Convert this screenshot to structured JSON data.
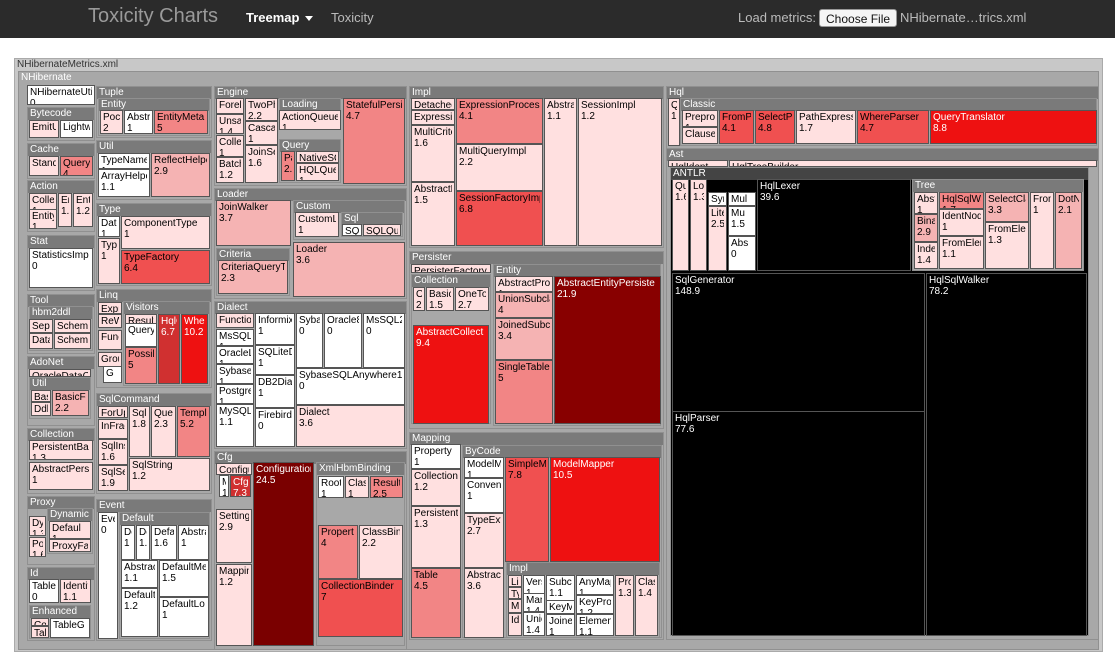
{
  "navbar": {
    "brand": "Toxicity Charts",
    "treemap_label": "Treemap",
    "toxicity_label": "Toxicity",
    "load_label": "Load metrics:",
    "choose_file_label": "Choose File",
    "file_name": "NHibernate…trics.xml"
  },
  "treemap": {
    "root_label": "NHibernateMetrics.xml",
    "main_label": "NHibernate",
    "groups": {
      "bytecode": "Bytecode",
      "cache": "Cache",
      "action": "Action",
      "stat": "Stat",
      "tool": "Tool",
      "hbm2ddl": "hbm2ddl",
      "adonet": "AdoNet",
      "util_left": "Util",
      "collection_left": "Collection",
      "proxy": "Proxy",
      "dynamic": "Dynamic",
      "id": "Id",
      "enhanced": "Enhanced",
      "tuple": "Tuple",
      "entity_tuple": "Entity",
      "util_mid": "Util",
      "type": "Type",
      "linq": "Linq",
      "visitors": "Visitors",
      "sqlcommand": "SqlCommand",
      "event": "Event",
      "default": "Default",
      "engine": "Engine",
      "loading": "Loading",
      "query": "Query",
      "loader": "Loader",
      "custom": "Custom",
      "sql": "Sql",
      "criteria": "Criteria",
      "dialect": "Dialect",
      "cfg": "Cfg",
      "xmlhbm": "XmlHbmBinding",
      "impl": "Impl",
      "persister": "Persister",
      "collection_p": "Collection",
      "entity_p": "Entity",
      "mapping": "Mapping",
      "bycode": "ByCode",
      "impl_bycode": "Impl",
      "hql": "Hql",
      "classic": "Classic",
      "ast": "Ast",
      "antlr": "ANTLR",
      "tree": "Tree"
    },
    "leaves": {
      "nhibernate_util": {
        "name": "NHibernateUti",
        "value": "0"
      },
      "emitu": {
        "name": "EmitU",
        "value": ""
      },
      "lightw": {
        "name": "Lightwe",
        "value": ""
      },
      "stand": {
        "name": "Stand",
        "value": ""
      },
      "queryh": {
        "name": "QueryH",
        "value": "4"
      },
      "collec": {
        "name": "Collec",
        "value": "1"
      },
      "en": {
        "name": "En",
        "value": "1.1"
      },
      "ent": {
        "name": "Ent",
        "value": "1.2"
      },
      "entity_a": {
        "name": "Entity",
        "value": "1"
      },
      "statistics": {
        "name": "StatisticsImp",
        "value": "0"
      },
      "sep": {
        "name": "Sep",
        "value": ""
      },
      "schem1": {
        "name": "Schem",
        "value": ""
      },
      "data": {
        "name": "Data",
        "value": ""
      },
      "schem2": {
        "name": "Schem",
        "value": ""
      },
      "oracledatac": {
        "name": "OracleDataC",
        "value": ""
      },
      "bas": {
        "name": "Bas",
        "value": ""
      },
      "basicfo": {
        "name": "BasicFo",
        "value": "2.2"
      },
      "ddl": {
        "name": "Ddl",
        "value": ""
      },
      "persistentba": {
        "name": "PersistentBa",
        "value": "1.3"
      },
      "abstractpers": {
        "name": "AbstractPers",
        "value": "1"
      },
      "dy": {
        "name": "Dy",
        "value": "1.3"
      },
      "defaul_p": {
        "name": "Defaul",
        "value": "1"
      },
      "po": {
        "name": "Po",
        "value": "1.6"
      },
      "proxyfa": {
        "name": "ProxyFa",
        "value": "1"
      },
      "tablec": {
        "name": "TableG",
        "value": "0"
      },
      "identif": {
        "name": "Identif",
        "value": "1.1"
      },
      "con": {
        "name": "Con",
        "value": ""
      },
      "tab": {
        "name": "Tab",
        "value": ""
      },
      "tableg": {
        "name": "TableG",
        "value": ""
      },
      "poco": {
        "name": "Poco",
        "value": "2"
      },
      "abstra_t": {
        "name": "Abstra",
        "value": "1"
      },
      "entitymeta": {
        "name": "EntityMeta",
        "value": "5"
      },
      "typename": {
        "name": "TypeName",
        "value": "1"
      },
      "arrayhelpe": {
        "name": "ArrayHelpe",
        "value": "1.1"
      },
      "reflecthelper": {
        "name": "ReflectHelpe",
        "value": "2.9"
      },
      "date": {
        "name": "Date",
        "value": "1"
      },
      "typ_t": {
        "name": "Typ",
        "value": "1"
      },
      "componenttype": {
        "name": "ComponentType",
        "value": "1"
      },
      "typefactory": {
        "name": "TypeFactory",
        "value": "6.4"
      },
      "expr": {
        "name": "Expr",
        "value": ""
      },
      "rew": {
        "name": "ReW",
        "value": ""
      },
      "func": {
        "name": "Func",
        "value": ""
      },
      "grou": {
        "name": "Grou",
        "value": ""
      },
      "g": {
        "name": "G",
        "value": ""
      },
      "resultop": {
        "name": "Result",
        "value": ""
      },
      "querym": {
        "name": "Query",
        "value": ""
      },
      "possib": {
        "name": "Possib",
        "value": "5"
      },
      "hqlge": {
        "name": "HqlG",
        "value": "6.7"
      },
      "where": {
        "name": "Where",
        "value": "10.2"
      },
      "forup": {
        "name": "ForUp",
        "value": ""
      },
      "infrag": {
        "name": "InFrag",
        "value": ""
      },
      "sqlins": {
        "name": "SqlIns",
        "value": "1.6"
      },
      "sqlse": {
        "name": "SqlSe",
        "value": "1.9"
      },
      "sqlu": {
        "name": "SqlU",
        "value": "1.8"
      },
      "quer": {
        "name": "Quer",
        "value": "2.3"
      },
      "templ": {
        "name": "Templa",
        "value": "5.2"
      },
      "sqlstring": {
        "name": "SqlString",
        "value": "1.2"
      },
      "even": {
        "name": "Even",
        "value": "0"
      },
      "de1": {
        "name": "De",
        "value": "1"
      },
      "de2": {
        "name": "De",
        "value": "1.1"
      },
      "defa": {
        "name": "Defa",
        "value": "1.6"
      },
      "abstra_e": {
        "name": "Abstra",
        "value": "1"
      },
      "abstrac": {
        "name": "Abstrac",
        "value": "1.1"
      },
      "defaultme": {
        "name": "DefaultMe",
        "value": "1.5"
      },
      "defaultl": {
        "name": "Defaulti",
        "value": "1.2"
      },
      "defaultlo": {
        "name": "DefaultLo",
        "value": "1"
      },
      "forek": {
        "name": "Forek",
        "value": ""
      },
      "unsa": {
        "name": "Unsa",
        "value": "1.4"
      },
      "collec_e": {
        "name": "Collec",
        "value": "1"
      },
      "batch": {
        "name": "Batch",
        "value": "1.2"
      },
      "twoph": {
        "name": "TwoPh",
        "value": "2.2"
      },
      "cascad": {
        "name": "Cascad",
        "value": "1"
      },
      "joinse": {
        "name": "JoinSe",
        "value": "1.6"
      },
      "actionqueue": {
        "name": "ActionQueue",
        "value": "1"
      },
      "pa": {
        "name": "Pa",
        "value": "2.6"
      },
      "nativesq": {
        "name": "NativeSQ",
        "value": "1"
      },
      "hqlque": {
        "name": "HQLQue",
        "value": "1"
      },
      "statefulpersi": {
        "name": "StatefulPersi",
        "value": "4.7"
      },
      "joinwalker": {
        "name": "JoinWalker",
        "value": "3.7"
      },
      "customl": {
        "name": "CustomL",
        "value": "1"
      },
      "sqlq": {
        "name": "SQL",
        "value": ""
      },
      "sqlqu": {
        "name": "SQLQu",
        "value": ""
      },
      "loader_leaf": {
        "name": "Loader",
        "value": "3.6"
      },
      "criteriaquery": {
        "name": "CriteriaQueryT",
        "value": "2.3"
      },
      "functio": {
        "name": "Functio",
        "value": ""
      },
      "mssqlc": {
        "name": "MsSQLC",
        "value": "1"
      },
      "oraclel": {
        "name": "OracleL",
        "value": "1"
      },
      "sybase": {
        "name": "Sybase",
        "value": "1"
      },
      "postgre": {
        "name": "Postgre",
        "value": "1"
      },
      "mysql": {
        "name": "MySQL",
        "value": "1.1"
      },
      "informix": {
        "name": "Informix",
        "value": "1"
      },
      "sqlited": {
        "name": "SQLiteD",
        "value": "1"
      },
      "db2dial": {
        "name": "DB2Dial",
        "value": "1"
      },
      "firebird": {
        "name": "Firebird",
        "value": "0"
      },
      "syba": {
        "name": "Syba",
        "value": "0"
      },
      "oracle8": {
        "name": "Oracle8",
        "value": "0"
      },
      "mssql20": {
        "name": "MsSQL20",
        "value": "0"
      },
      "sybaseany": {
        "name": "SybaseSQLAnywhere1",
        "value": "0"
      },
      "dialect_leaf": {
        "name": "Dialect",
        "value": "3.6"
      },
      "configu": {
        "name": "Configu",
        "value": ""
      },
      "m": {
        "name": "M",
        "value": "1"
      },
      "cfg_leaf": {
        "name": "Cfg.",
        "value": "7.3"
      },
      "setting": {
        "name": "Setting",
        "value": "2.9"
      },
      "mappin": {
        "name": "Mappin",
        "value": "1.2"
      },
      "configuration": {
        "name": "Configuration",
        "value": "24.5"
      },
      "root": {
        "name": "Root",
        "value": "1"
      },
      "class_x": {
        "name": "Class",
        "value": "1"
      },
      "result_x": {
        "name": "Result",
        "value": "2.5"
      },
      "propert": {
        "name": "Propert",
        "value": "4"
      },
      "classbin": {
        "name": "ClassBin",
        "value": "2.2"
      },
      "collectionbinder": {
        "name": "CollectionBinder",
        "value": "7"
      },
      "detached": {
        "name": "Detached",
        "value": ""
      },
      "expressio": {
        "name": "Expressio",
        "value": ""
      },
      "multicrite": {
        "name": "MultiCrite",
        "value": "1.6"
      },
      "abstractd": {
        "name": "AbstractD",
        "value": "1.5"
      },
      "expressionproces": {
        "name": "ExpressionProces",
        "value": "4.1"
      },
      "multiqueryimpl": {
        "name": "MultiQueryImpl",
        "value": "2.2"
      },
      "sessionfactoryimp": {
        "name": "SessionFactoryImp",
        "value": "6.8"
      },
      "abstra_i": {
        "name": "Abstra",
        "value": "1.1"
      },
      "sessionimpl": {
        "name": "SessionImpl",
        "value": "1.2"
      },
      "persisterfactory": {
        "name": "PersisterFactory",
        "value": ""
      },
      "oc": {
        "name": "O",
        "value": "2.1"
      },
      "basic": {
        "name": "Basic",
        "value": "1.5"
      },
      "oneto": {
        "name": "OneTo",
        "value": "2.7"
      },
      "abstractcollec": {
        "name": "AbstractCollect",
        "value": "9.4"
      },
      "abstractprop": {
        "name": "AbstractProp",
        "value": "1"
      },
      "unionsubcl": {
        "name": "UnionSubcla",
        "value": "4"
      },
      "joinedsubcl": {
        "name": "JoinedSubcl",
        "value": "3.4"
      },
      "singletable": {
        "name": "SingleTable",
        "value": "5"
      },
      "abstractentitypersiste": {
        "name": "AbstractEntityPersiste",
        "value": "21.9"
      },
      "property": {
        "name": "Property",
        "value": "1"
      },
      "collection_m": {
        "name": "Collection",
        "value": "1.2"
      },
      "persistent_m": {
        "name": "Persistent",
        "value": "1.3"
      },
      "table_m": {
        "name": "Table",
        "value": "4.5"
      },
      "modelma": {
        "name": "ModelMa",
        "value": "1"
      },
      "convent": {
        "name": "Convent",
        "value": "1"
      },
      "typeext": {
        "name": "TypeExt",
        "value": "2.7"
      },
      "abstract_bc": {
        "name": "Abstract",
        "value": "3.6"
      },
      "simplem": {
        "name": "SimpleM",
        "value": "7.8"
      },
      "modelmapper": {
        "name": "ModelMapper",
        "value": "10.5"
      },
      "list": {
        "name": "List",
        "value": ""
      },
      "typ_i": {
        "name": "Typ",
        "value": ""
      },
      "map_i": {
        "name": "Map",
        "value": ""
      },
      "idm": {
        "name": "IdM",
        "value": ""
      },
      "vers": {
        "name": "Vers",
        "value": "1"
      },
      "man": {
        "name": "Man",
        "value": "1.4"
      },
      "unio": {
        "name": "Unio",
        "value": "1.4"
      },
      "subc": {
        "name": "Subc",
        "value": "1.1"
      },
      "keym": {
        "name": "KeyM",
        "value": ""
      },
      "joine": {
        "name": "Joine",
        "value": "1"
      },
      "anymap": {
        "name": "AnyMap",
        "value": "1"
      },
      "keypro": {
        "name": "KeyPro",
        "value": "1.2"
      },
      "elemen": {
        "name": "Elemen",
        "value": "1.1"
      },
      "pro": {
        "name": "Pro",
        "value": "1.3"
      },
      "clas": {
        "name": "Clas",
        "value": "1.4"
      },
      "q_hql": {
        "name": "Q",
        "value": "1.7"
      },
      "preproc": {
        "name": "Preproc",
        "value": "1"
      },
      "clause": {
        "name": "Clause",
        "value": ""
      },
      "frompa": {
        "name": "FromPa",
        "value": "4.1"
      },
      "selectpa": {
        "name": "SelectPa",
        "value": "4.8"
      },
      "pathexpress": {
        "name": "PathExpress",
        "value": "1.7"
      },
      "whereparser": {
        "name": "WhereParser",
        "value": "4.7"
      },
      "querytranslator": {
        "name": "QueryTranslator",
        "value": "8.8"
      },
      "hqlident": {
        "name": "HqlIdent",
        "value": ""
      },
      "hqltreebuilder": {
        "name": "HqlTreeBuilder",
        "value": ""
      },
      "qu": {
        "name": "Qu",
        "value": "1.6"
      },
      "loa": {
        "name": "Loa",
        "value": "1.3"
      },
      "syr": {
        "name": "Syr",
        "value": "1"
      },
      "lite": {
        "name": "Lite",
        "value": "2.5"
      },
      "mul": {
        "name": "Mul",
        "value": "1"
      },
      "mu": {
        "name": "Mu",
        "value": "1.5"
      },
      "abs": {
        "name": "Abs",
        "value": "0"
      },
      "hqllexer": {
        "name": "HqlLexer",
        "value": "39.6"
      },
      "abstr_tree": {
        "name": "Abstr",
        "value": "1"
      },
      "bina": {
        "name": "Bina",
        "value": "2.9"
      },
      "inde": {
        "name": "Inde",
        "value": "1.4"
      },
      "hqlsqlw": {
        "name": "HqlSqlWa",
        "value": "1.7"
      },
      "identnod": {
        "name": "IdentNod",
        "value": "1"
      },
      "fromelen": {
        "name": "FromElen",
        "value": "1.1"
      },
      "selectcla": {
        "name": "SelectCla",
        "value": "3.3"
      },
      "fromele": {
        "name": "FromEle",
        "value": "1.3"
      },
      "from_t": {
        "name": "From",
        "value": "1"
      },
      "dotn": {
        "name": "DotN",
        "value": "2.1"
      },
      "sqlgenerator": {
        "name": "SqlGenerator",
        "value": "148.9"
      },
      "hqlsqlwalker": {
        "name": "HqlSqlWalker",
        "value": "78.2"
      },
      "hqlparser": {
        "name": "HqlParser",
        "value": "77.6"
      }
    }
  }
}
